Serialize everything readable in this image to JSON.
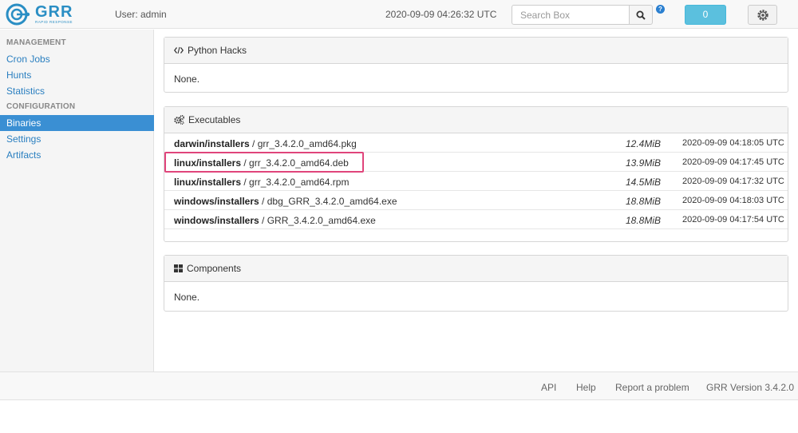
{
  "header": {
    "logo_text": "GRR",
    "logo_subtext": "RAPID RESPONSE",
    "user_label": "User: admin",
    "clock": "2020-09-09 04:26:32 UTC",
    "search_placeholder": "Search Box",
    "help_badge": "?",
    "notification_count": "0"
  },
  "sidebar": {
    "management_heading": "MANAGEMENT",
    "management_items": [
      {
        "label": "Cron Jobs"
      },
      {
        "label": "Hunts"
      },
      {
        "label": "Statistics"
      }
    ],
    "configuration_heading": "CONFIGURATION",
    "configuration_items": [
      {
        "label": "Binaries",
        "active": true
      },
      {
        "label": "Settings"
      },
      {
        "label": "Artifacts"
      }
    ]
  },
  "python_hacks": {
    "title": "Python Hacks",
    "body": "None."
  },
  "executables": {
    "title": "Executables",
    "rows": [
      {
        "dir": "darwin/installers",
        "sep": " / ",
        "file": "grr_3.4.2.0_amd64.pkg",
        "size": "12.4MiB",
        "date": "2020-09-09 04:18:05 UTC"
      },
      {
        "dir": "linux/installers",
        "sep": " / ",
        "file": "grr_3.4.2.0_amd64.deb",
        "size": "13.9MiB",
        "date": "2020-09-09 04:17:45 UTC"
      },
      {
        "dir": "linux/installers",
        "sep": " / ",
        "file": "grr_3.4.2.0_amd64.rpm",
        "size": "14.5MiB",
        "date": "2020-09-09 04:17:32 UTC"
      },
      {
        "dir": "windows/installers",
        "sep": " / ",
        "file": "dbg_GRR_3.4.2.0_amd64.exe",
        "size": "18.8MiB",
        "date": "2020-09-09 04:18:03 UTC"
      },
      {
        "dir": "windows/installers",
        "sep": " / ",
        "file": "GRR_3.4.2.0_amd64.exe",
        "size": "18.8MiB",
        "date": "2020-09-09 04:17:54 UTC"
      }
    ]
  },
  "components": {
    "title": "Components",
    "body": "None."
  },
  "footer": {
    "api": "API",
    "help": "Help",
    "report": "Report a problem",
    "version": "GRR Version 3.4.2.0"
  },
  "colors": {
    "accent": "#3a8fd3",
    "link": "#2a7fc0",
    "highlight": "#e0457b",
    "notification": "#5bc0de"
  },
  "icons": {
    "search": "search-icon",
    "settings": "gear-icon",
    "python_hacks": "code-icon",
    "executables": "gears-icon",
    "components": "th-large-icon"
  }
}
